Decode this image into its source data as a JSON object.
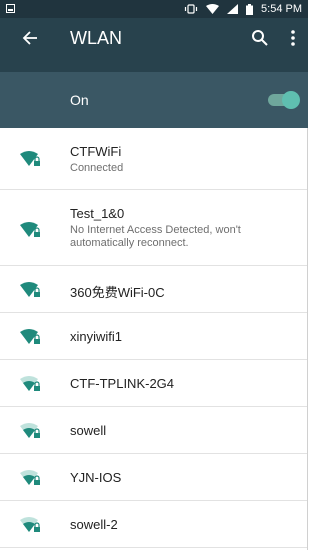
{
  "status_bar": {
    "time": "5:54 PM"
  },
  "app_bar": {
    "title": "WLAN"
  },
  "master_switch": {
    "label": "On",
    "state": true,
    "accent": "#5fbfb0"
  },
  "networks": [
    {
      "name": "CTFWiFi",
      "status": "Connected",
      "locked": true,
      "signal": "full"
    },
    {
      "name": "Test_1&0",
      "status": "No Internet Access Detected, won't automatically reconnect.",
      "locked": true,
      "signal": "full"
    },
    {
      "name": "360免费WiFi-0C",
      "status": "",
      "locked": true,
      "signal": "full"
    },
    {
      "name": "xinyiwifi1",
      "status": "",
      "locked": true,
      "signal": "full"
    },
    {
      "name": "CTF-TPLINK-2G4",
      "status": "",
      "locked": true,
      "signal": "medium"
    },
    {
      "name": "sowell",
      "status": "",
      "locked": true,
      "signal": "medium"
    },
    {
      "name": "YJN-IOS",
      "status": "",
      "locked": true,
      "signal": "medium"
    },
    {
      "name": "sowell-2",
      "status": "",
      "locked": true,
      "signal": "medium"
    }
  ],
  "icons": {
    "back": "arrow-back-icon",
    "search": "search-icon",
    "more": "more-vert-icon",
    "wifi": "wifi-lock-icon"
  },
  "colors": {
    "status_bar": "#20343e",
    "app_bar": "#28424d",
    "switch_bar": "#3a5764",
    "wifi_full": "#1f8a7c",
    "wifi_empty": "#bfe2dc"
  }
}
